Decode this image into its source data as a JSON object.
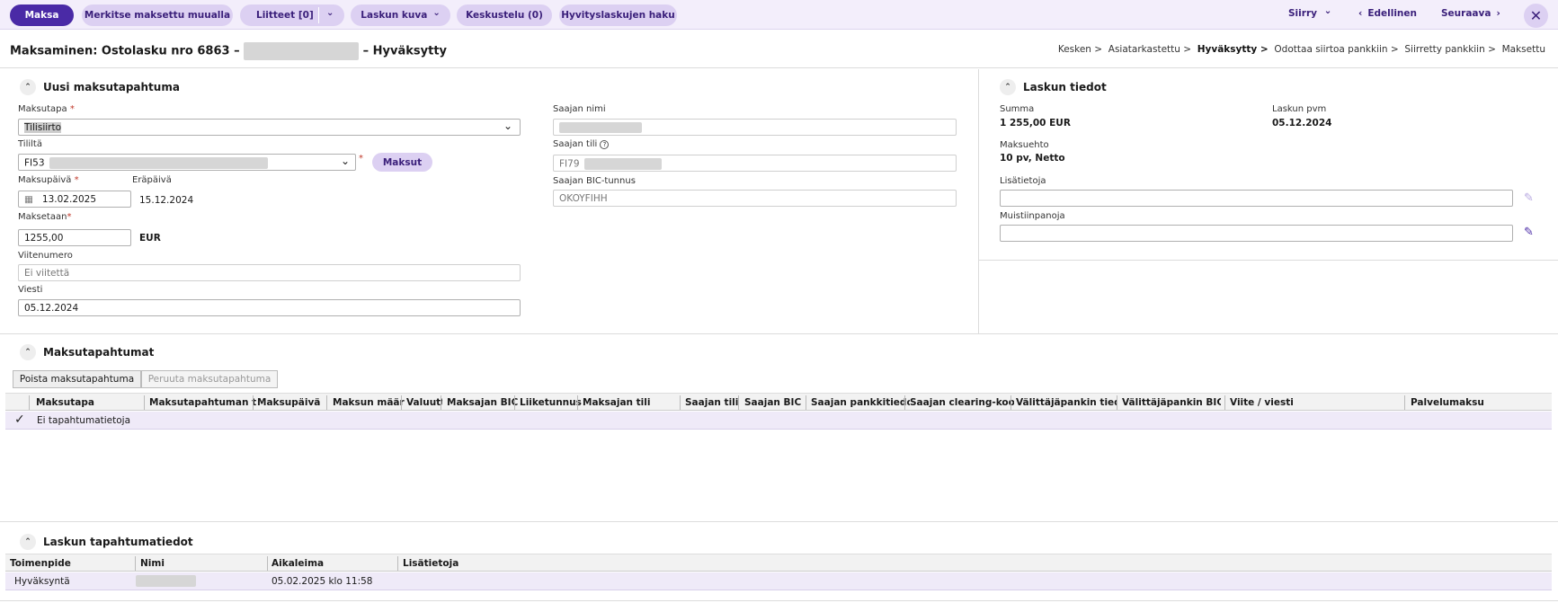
{
  "toolbar": {
    "pay": "Maksa",
    "mark_paid": "Merkitse maksettu muualla",
    "attachments": "Liitteet [0]",
    "invoice_image": "Laskun kuva",
    "discussion": "Keskustelu (0)",
    "credit_search": "Hyvityslaskujen haku",
    "move": "Siirry",
    "previous": "Edellinen",
    "next": "Seuraava"
  },
  "title": {
    "prefix": "Maksaminen: Ostolasku nro 6863 –",
    "suffix": "– Hyväksytty"
  },
  "breadcrumbs": [
    {
      "label": "Kesken >",
      "current": false
    },
    {
      "label": "Asiatarkastettu >",
      "current": false
    },
    {
      "label": "Hyväksytty >",
      "current": true
    },
    {
      "label": "Odottaa siirtoa pankkiin >",
      "current": false
    },
    {
      "label": "Siirretty pankkiin >",
      "current": false
    },
    {
      "label": "Maksettu",
      "current": false
    }
  ],
  "new_payment": {
    "heading": "Uusi maksutapahtuma",
    "method_label": "Maksutapa",
    "method_value": "Tilisiirto",
    "from_account_label": "Tililtä",
    "from_account_value": "FI53",
    "payments_button": "Maksut",
    "pay_date_label": "Maksupäivä",
    "pay_date_value": "13.02.2025",
    "due_date_label": "Eräpäivä",
    "due_date_value": "15.12.2024",
    "amount_label": "Maksetaan",
    "amount_value": "1255,00",
    "currency": "EUR",
    "reference_label": "Viitenumero",
    "reference_placeholder": "Ei viitettä",
    "message_label": "Viesti",
    "message_value": "05.12.2024",
    "recipient_name_label": "Saajan nimi",
    "recipient_account_label": "Saajan tili",
    "recipient_account_value": "FI79",
    "recipient_bic_label": "Saajan BIC-tunnus",
    "recipient_bic_value": "OKOYFIHH",
    "required_mark": "*"
  },
  "invoice_info": {
    "heading": "Laskun tiedot",
    "sum_label": "Summa",
    "sum_value": "1 255,00 EUR",
    "invoice_date_label": "Laskun pvm",
    "invoice_date_value": "05.12.2024",
    "terms_label": "Maksuehto",
    "terms_value": "10 pv, Netto",
    "extra_label": "Lisätietoja",
    "notes_label": "Muistiinpanoja"
  },
  "payments": {
    "heading": "Maksutapahtumat",
    "delete_button": "Poista maksutapahtuma",
    "cancel_button": "Peruuta maksutapahtuma",
    "columns": [
      "Maksutapa",
      "Maksutapahtuman tila",
      "Maksupäivä",
      "Maksun määrä",
      "Valuutta",
      "Maksajan BIC",
      "Liiketunnus",
      "Maksajan tili",
      "Saajan tili",
      "Saajan BIC",
      "Saajan pankkitiedot",
      "Saajan clearing-koodi",
      "Välittäjäpankin tiedot",
      "Välittäjäpankin BIC-tunnus",
      "Viite / viesti",
      "Palvelumaksu"
    ],
    "empty_text": "Ei tapahtumatietoja"
  },
  "events": {
    "heading": "Laskun tapahtumatiedot",
    "columns": [
      "Toimenpide",
      "Nimi",
      "Aikaleima",
      "Lisätietoja"
    ],
    "rows": [
      {
        "action": "Hyväksyntä",
        "timestamp": "05.02.2025 klo 11:58"
      }
    ]
  }
}
